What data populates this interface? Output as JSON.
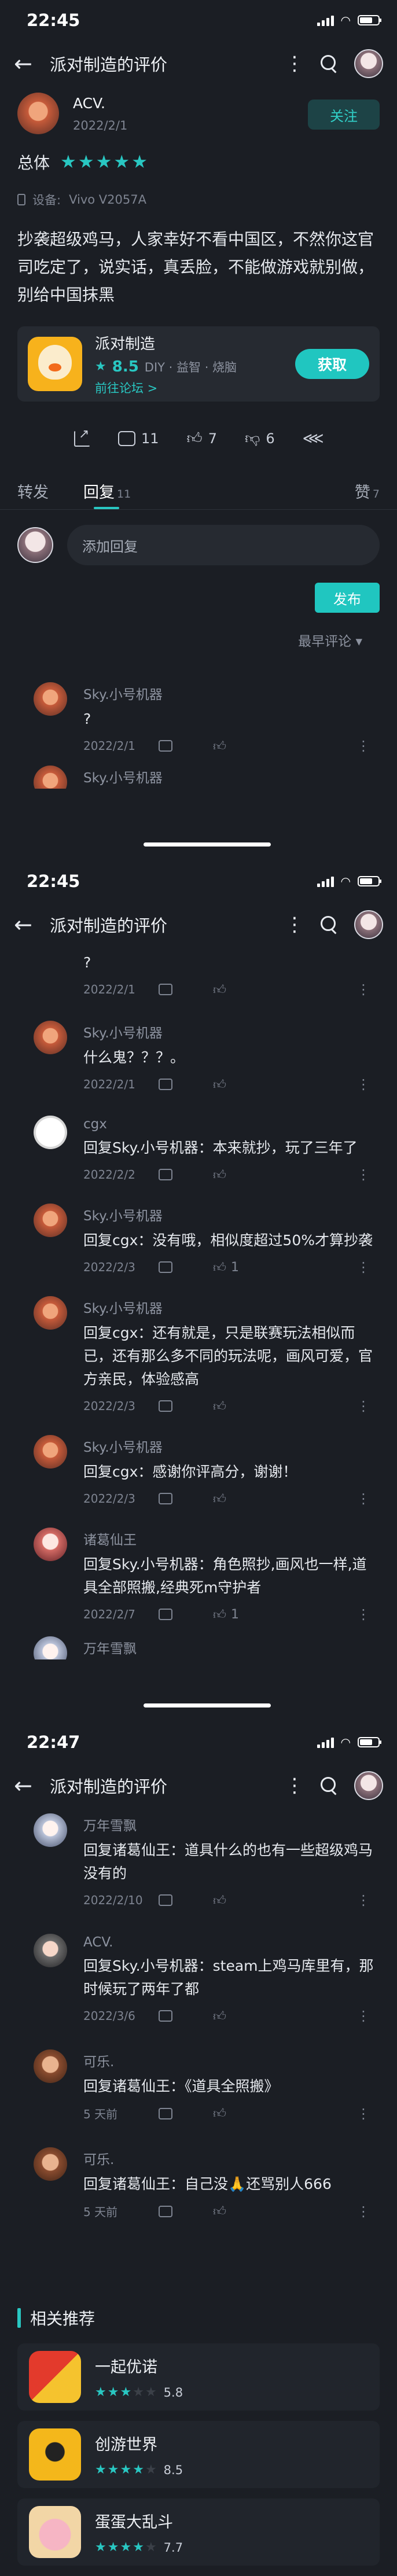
{
  "screens": [
    {
      "status_time": "22:45"
    },
    {
      "status_time": "22:45"
    },
    {
      "status_time": "22:47"
    }
  ],
  "app_bar": {
    "title": "派对制造的评价",
    "back_icon": "arrow-left-icon",
    "more_icon": "more-vertical-icon",
    "search_icon": "search-icon"
  },
  "review": {
    "author": "ACV.",
    "date": "2022/2/1",
    "follow_label": "关注",
    "rating_label": "总体",
    "stars": 5,
    "device_label": "设备:",
    "device_value": "Vivo V2057A",
    "body": "抄袭超级鸡马，人家幸好不看中国区，不然你这官司吃定了，说实话，真丢脸，不能做游戏就别做，别给中国抹黑"
  },
  "game": {
    "name": "派对制造",
    "score": "8.5",
    "tags": "DIY · 益智 · 烧脑",
    "link": "前往论坛 >",
    "get_label": "获取"
  },
  "actions": {
    "comments": "11",
    "likes": "7",
    "dislikes": "6"
  },
  "tabs": {
    "repost": "转发",
    "reply": "回复",
    "reply_count": "11",
    "like": "赞",
    "like_count": "7"
  },
  "reply_box": {
    "placeholder": "添加回复",
    "publish_label": "发布"
  },
  "sort_label": "最早评论 ▾",
  "comments": [
    {
      "name": "Sky.小号机器",
      "text": "?",
      "date": "2022/2/1",
      "likes": ""
    },
    {
      "name": "Sky.小号机器",
      "text": "?",
      "date": "2022/2/1",
      "likes": ""
    },
    {
      "name": "Sky.小号机器",
      "text": "什么鬼？？？。",
      "date": "2022/2/1",
      "likes": ""
    },
    {
      "name": "cgx",
      "text": "回复Sky.小号机器：本来就抄，玩了三年了",
      "date": "2022/2/2",
      "likes": ""
    },
    {
      "name": "Sky.小号机器",
      "text": "回复cgx：没有哦，相似度超过50%才算抄袭",
      "date": "2022/2/3",
      "likes": "1"
    },
    {
      "name": "Sky.小号机器",
      "text": "回复cgx：还有就是，只是联赛玩法相似而已，还有那么多不同的玩法呢，画风可爱，官方亲民，体验感高",
      "date": "2022/2/3",
      "likes": ""
    },
    {
      "name": "Sky.小号机器",
      "text": "回复cgx：感谢你评高分，谢谢！",
      "date": "2022/2/3",
      "likes": ""
    },
    {
      "name": "诸葛仙王",
      "text": "回复Sky.小号机器：角色照抄,画风也一样,道具全部照搬,经典死m守护者",
      "date": "2022/2/7",
      "likes": "1"
    },
    {
      "name": "万年雪飘",
      "text": "回复诸葛仙王：道具什么的也有一些超级鸡马没有的",
      "date": "2022/2/10",
      "likes": ""
    },
    {
      "name": "ACV.",
      "text": "回复Sky.小号机器：steam上鸡马库里有，那时候玩了两年了都",
      "date": "2022/3/6",
      "likes": ""
    },
    {
      "name": "可乐.",
      "text": "回复诸葛仙王：《道具全照搬》",
      "date": "5 天前",
      "likes": ""
    },
    {
      "name": "可乐.",
      "text": "回复诸葛仙王：自己没🙏还骂别人666",
      "date": "5 天前",
      "likes": ""
    }
  ],
  "partial_name": "万年雪飘",
  "recommend": {
    "title": "相关推荐",
    "items": [
      {
        "name": "一起优诺",
        "score": "5.8",
        "stars": 3
      },
      {
        "name": "创游世界",
        "score": "8.5",
        "stars": 4
      },
      {
        "name": "蛋蛋大乱斗",
        "score": "7.7",
        "stars": 4
      }
    ]
  },
  "colors": {
    "background": "#1b1e24",
    "accent": "#29c7c2",
    "card": "#262a31"
  }
}
